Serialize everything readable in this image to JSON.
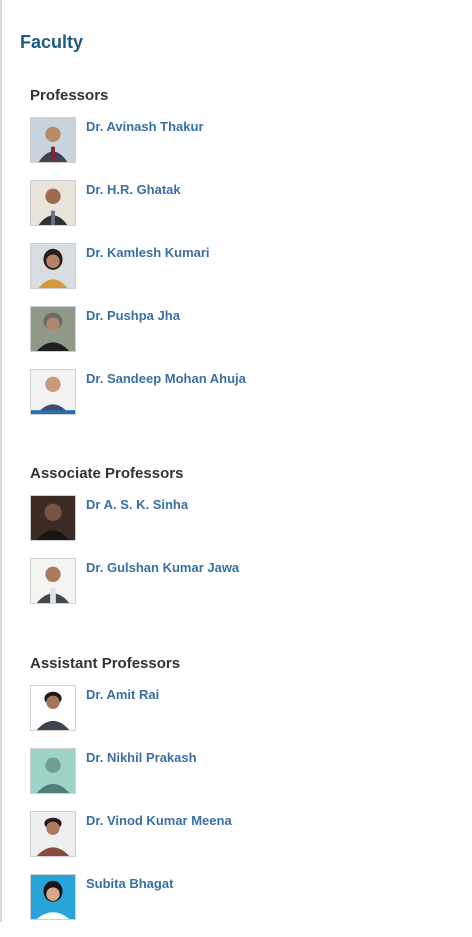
{
  "page_title": "Faculty",
  "sections": [
    {
      "heading": "Professors",
      "people": [
        {
          "name": "Dr. Avinash Thakur",
          "photo": "portrait-photo"
        },
        {
          "name": "Dr. H.R. Ghatak",
          "photo": "portrait-photo"
        },
        {
          "name": "Dr. Kamlesh Kumari",
          "photo": "portrait-photo"
        },
        {
          "name": "Dr. Pushpa Jha",
          "photo": "portrait-photo"
        },
        {
          "name": "Dr. Sandeep Mohan Ahuja",
          "photo": "portrait-photo"
        }
      ]
    },
    {
      "heading": "Associate Professors",
      "people": [
        {
          "name": "Dr A. S. K. Sinha",
          "photo": "portrait-photo"
        },
        {
          "name": "Dr. Gulshan Kumar Jawa",
          "photo": "portrait-photo"
        }
      ]
    },
    {
      "heading": "Assistant Professors",
      "people": [
        {
          "name": "Dr. Amit Rai",
          "photo": "portrait-photo"
        },
        {
          "name": "Dr. Nikhil Prakash",
          "photo": "portrait-photo"
        },
        {
          "name": "Dr. Vinod Kumar Meena",
          "photo": "portrait-photo"
        },
        {
          "name": "Subita Bhagat",
          "photo": "portrait-photo"
        }
      ]
    }
  ],
  "colors": {
    "title": "#1f5b86",
    "heading": "#333333",
    "link": "#3a6fa5"
  }
}
